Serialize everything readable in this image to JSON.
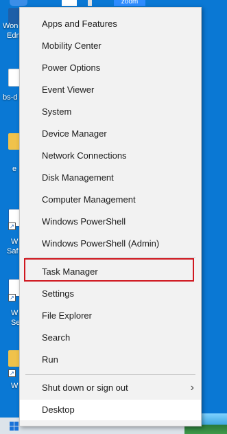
{
  "desktop": {
    "icons": [
      {
        "label": "Won",
        "label2": "Edn"
      },
      {
        "label": "bs-d"
      },
      {
        "label": "e"
      },
      {
        "label": "W",
        "label2": "Saf"
      },
      {
        "label": "W",
        "label2": "Se"
      },
      {
        "label": "W"
      }
    ],
    "top_apps": {
      "zoom_label": "zoom"
    },
    "colors": {
      "background": "#0a78d4",
      "menu_bg": "#f2f2f2",
      "highlight": "#d0171f"
    }
  },
  "menu": {
    "group1": [
      {
        "label": "Apps and Features"
      },
      {
        "label": "Mobility Center"
      },
      {
        "label": "Power Options"
      },
      {
        "label": "Event Viewer"
      },
      {
        "label": "System"
      },
      {
        "label": "Device Manager"
      },
      {
        "label": "Network Connections"
      },
      {
        "label": "Disk Management"
      },
      {
        "label": "Computer Management"
      },
      {
        "label": "Windows PowerShell"
      },
      {
        "label": "Windows PowerShell (Admin)"
      }
    ],
    "group2": [
      {
        "label": "Task Manager"
      },
      {
        "label": "Settings"
      },
      {
        "label": "File Explorer"
      },
      {
        "label": "Search"
      },
      {
        "label": "Run"
      }
    ],
    "group3": [
      {
        "label": "Shut down or sign out",
        "has_submenu": true,
        "icon": "chevron-right-icon"
      },
      {
        "label": "Desktop"
      }
    ]
  }
}
